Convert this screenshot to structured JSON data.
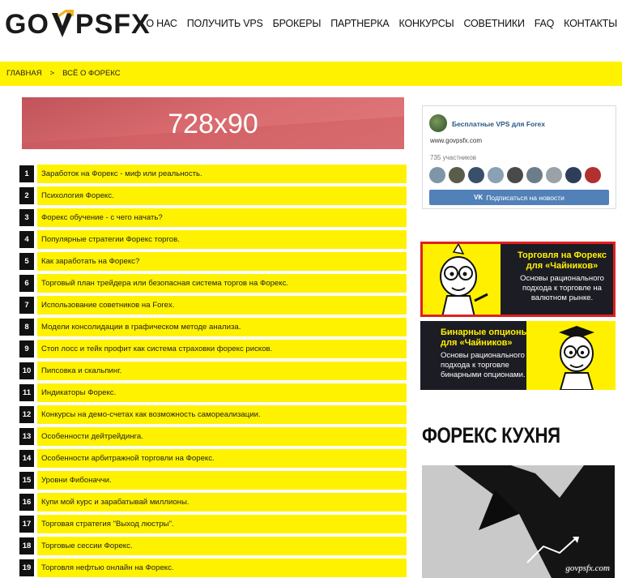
{
  "header": {
    "logo_text_left": "GO",
    "logo_text_right": "PSFX",
    "nav": [
      "О НАС",
      "ПОЛУЧИТЬ VPS",
      "БРОКЕРЫ",
      "ПАРТНЕРКА",
      "КОНКУРСЫ",
      "СОВЕТНИКИ",
      "FAQ",
      "КОНТАКТЫ"
    ]
  },
  "breadcrumb": {
    "home": "ГЛАВНАЯ",
    "separator": ">",
    "current": "ВСЁ О ФОРЕКС"
  },
  "ad_banner": {
    "label": "728x90"
  },
  "articles": [
    {
      "num": "1",
      "title": "Заработок на Форекс - миф или реальность."
    },
    {
      "num": "2",
      "title": "Психология Форекс."
    },
    {
      "num": "3",
      "title": "Форекс обучение - с чего начать?"
    },
    {
      "num": "4",
      "title": "Популярные стратегии Форекс торгов."
    },
    {
      "num": "5",
      "title": "Как заработать на Форекс?"
    },
    {
      "num": "6",
      "title": "Торговый план трейдера или безопасная система торгов на Форекс."
    },
    {
      "num": "7",
      "title": "Использование советников на Forex."
    },
    {
      "num": "8",
      "title": "Модели консолидации в графическом методе анализа."
    },
    {
      "num": "9",
      "title": "Стоп лосс и тейк профит как система страховки форекс рисков."
    },
    {
      "num": "10",
      "title": "Пипсовка и скальпинг."
    },
    {
      "num": "11",
      "title": "Индикаторы Форекс."
    },
    {
      "num": "12",
      "title": "Конкурсы на демо-счетах как возможность самореализации."
    },
    {
      "num": "13",
      "title": "Особенности дейтрейдинга."
    },
    {
      "num": "14",
      "title": "Особенности арбитражной торговли на Форекс."
    },
    {
      "num": "15",
      "title": "Уровни Фибоначчи."
    },
    {
      "num": "16",
      "title": "Купи мой курс и зарабатывай миллионы."
    },
    {
      "num": "17",
      "title": "Торговая стратегия \"Выход люстры\"."
    },
    {
      "num": "18",
      "title": "Торговые сессии Форекс."
    },
    {
      "num": "19",
      "title": "Торговля нефтью онлайн на Форекс."
    }
  ],
  "vk_widget": {
    "title": "Бесплатные VPS для Forex",
    "url": "www.govpsfx.com",
    "members": "735 участников",
    "subscribe": "Подписаться на новости",
    "button_color": "#5181b8"
  },
  "promo1": {
    "head_line1": "Торговля на Форекс",
    "head_line2": "для «Чайников»",
    "body": "Основы рационального подхода к торговле на валютном рынке."
  },
  "promo2": {
    "head_line1": "Бинарные опционы",
    "head_line2": "для «Чайников»",
    "body": "Основы рационального подхода к торговле бинарными опционами."
  },
  "section_title": "ФОРЕКС КУХНЯ",
  "watermark": "govpsfx.com",
  "colors": {
    "accent_yellow": "#fff200",
    "dark": "#111111",
    "ad_red": "#d86a6e"
  }
}
